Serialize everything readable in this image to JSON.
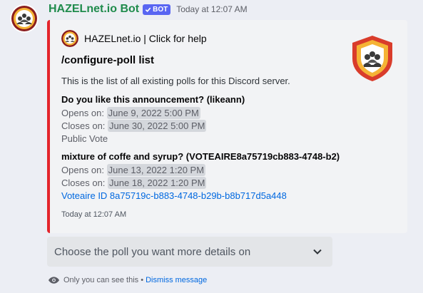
{
  "message": {
    "username": "HAZELnet.io Bot",
    "bot_tag": "BOT",
    "timestamp": "Today at 12:07 AM"
  },
  "embed": {
    "accent_color": "#e3242b",
    "author": "HAZELnet.io | Click for help",
    "title": "/configure-poll list",
    "description": "This is the list of all existing polls for this Discord server.",
    "fields": [
      {
        "name": "Do you like this announcement? (likeann)",
        "opens_label": "Opens on: ",
        "opens_value": "June 9, 2022 5:00 PM",
        "closes_label": "Closes on: ",
        "closes_value": "June 30, 2022 5:00 PM",
        "extra": "Public Vote"
      },
      {
        "name": "mixture of coffe and syrup? (VOTEAIRE8a75719cb883-4748-b2)",
        "opens_label": "Opens on: ",
        "opens_value": "June 13, 2022 1:20 PM",
        "closes_label": "Closes on: ",
        "closes_value": "June 18, 2022 1:20 PM",
        "extra": "Voteaire ID 8a75719c-b883-4748-b29b-b8b717d5a448"
      }
    ],
    "footer": "Today at 12:07 AM"
  },
  "select_menu": {
    "placeholder": "Choose the poll you want more details on",
    "icon": "chevron-down-icon"
  },
  "ephemeral": {
    "icon": "eye-icon",
    "text": "Only you can see this •",
    "dismiss": "Dismiss message"
  }
}
